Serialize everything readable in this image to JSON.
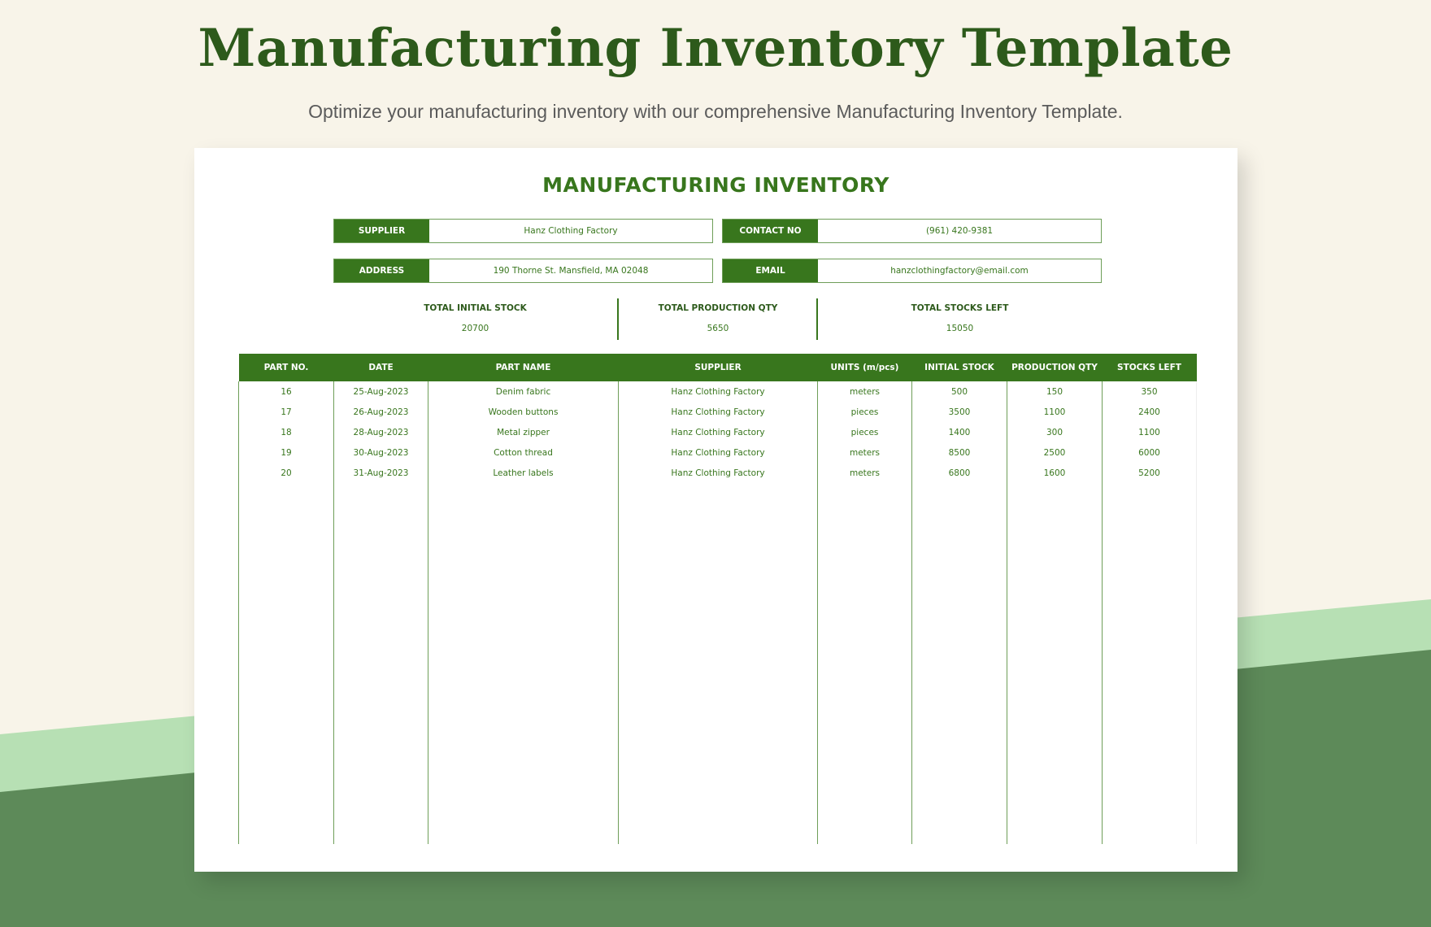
{
  "page": {
    "title": "Manufacturing Inventory Template",
    "subtitle": "Optimize your manufacturing inventory with our comprehensive Manufacturing Inventory Template.",
    "colors": {
      "background": "#f8f4e9",
      "light_green": "#b7e0b4",
      "dark_green": "#5d8a59",
      "accent": "#38761d",
      "title": "#2d5a1b"
    }
  },
  "sheet": {
    "title": "MANUFACTURING INVENTORY",
    "info": {
      "supplier_label": "SUPPLIER",
      "supplier_value": "Hanz Clothing Factory",
      "contact_label": "CONTACT NO",
      "contact_value": "(961) 420-9381",
      "address_label": "ADDRESS",
      "address_value": "190 Thorne St. Mansfield, MA 02048",
      "email_label": "EMAIL",
      "email_value": "hanzclothingfactory@email.com"
    },
    "summary": {
      "initial_label": "TOTAL INITIAL STOCK",
      "initial_value": "20700",
      "production_label": "TOTAL PRODUCTION QTY",
      "production_value": "5650",
      "left_label": "TOTAL STOCKS LEFT",
      "left_value": "15050"
    },
    "table": {
      "headers": [
        "PART NO.",
        "DATE",
        "PART NAME",
        "SUPPLIER",
        "UNITS (m/pcs)",
        "INITIAL STOCK",
        "PRODUCTION QTY",
        "STOCKS LEFT"
      ],
      "rows": [
        [
          "16",
          "25-Aug-2023",
          "Denim fabric",
          "Hanz Clothing Factory",
          "meters",
          "500",
          "150",
          "350"
        ],
        [
          "17",
          "26-Aug-2023",
          "Wooden buttons",
          "Hanz Clothing Factory",
          "pieces",
          "3500",
          "1100",
          "2400"
        ],
        [
          "18",
          "28-Aug-2023",
          "Metal zipper",
          "Hanz Clothing Factory",
          "pieces",
          "1400",
          "300",
          "1100"
        ],
        [
          "19",
          "30-Aug-2023",
          "Cotton thread",
          "Hanz Clothing Factory",
          "meters",
          "8500",
          "2500",
          "6000"
        ],
        [
          "20",
          "31-Aug-2023",
          "Leather labels",
          "Hanz Clothing Factory",
          "meters",
          "6800",
          "1600",
          "5200"
        ]
      ]
    }
  }
}
